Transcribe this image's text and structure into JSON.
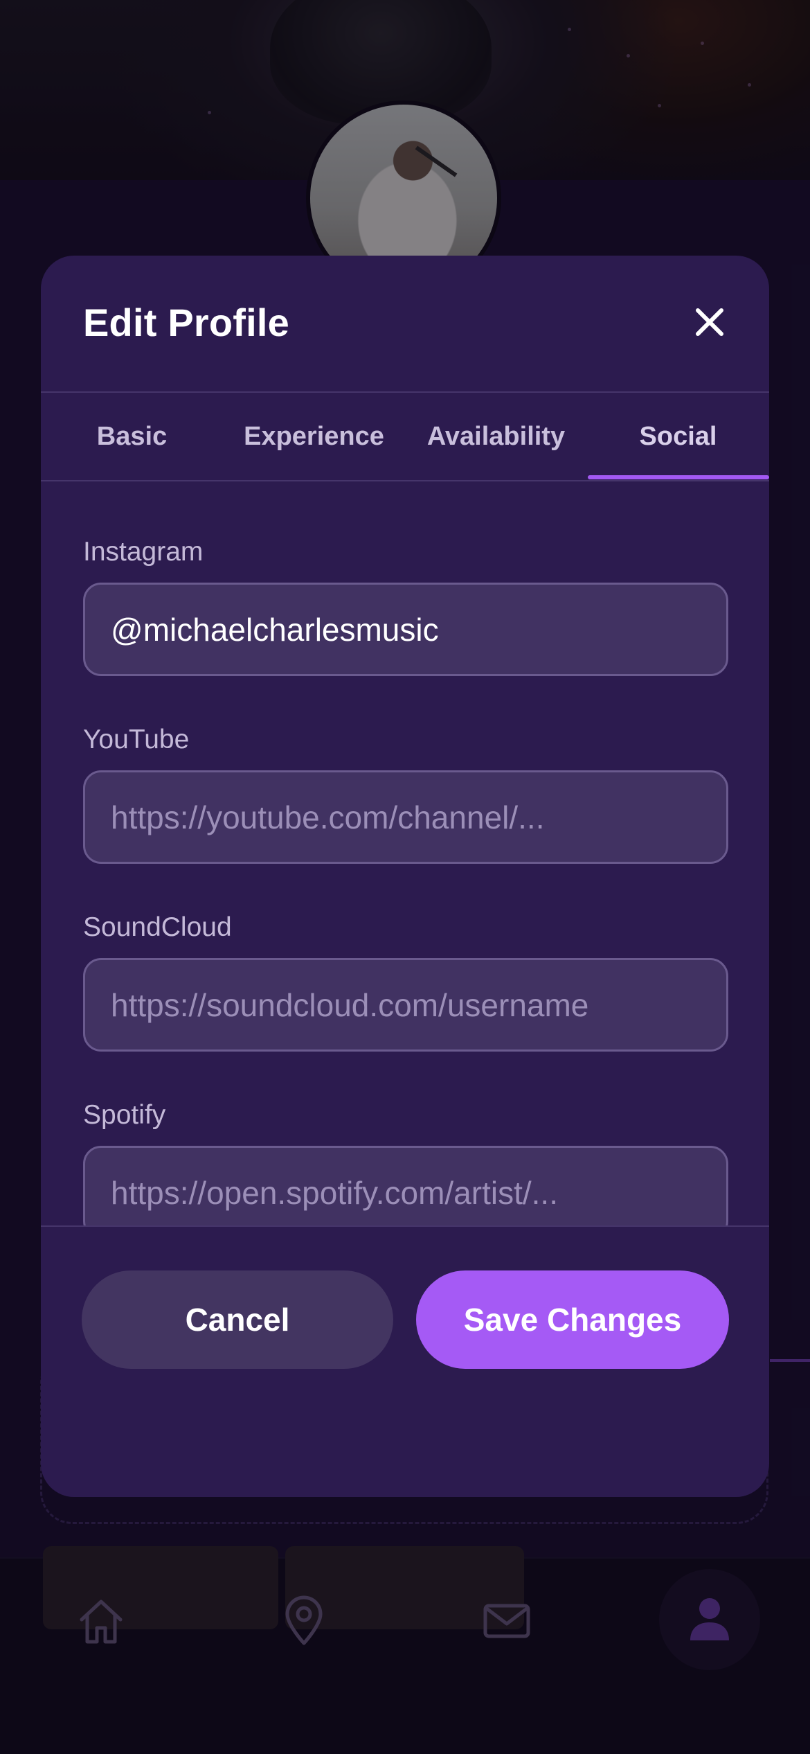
{
  "modal": {
    "title": "Edit Profile",
    "close_icon": "close-icon"
  },
  "tabs": [
    {
      "label": "Basic",
      "active": false
    },
    {
      "label": "Experience",
      "active": false
    },
    {
      "label": "Availability",
      "active": false
    },
    {
      "label": "Social",
      "active": true
    }
  ],
  "fields": {
    "instagram": {
      "label": "Instagram",
      "value": "@michaelcharlesmusic",
      "placeholder": ""
    },
    "youtube": {
      "label": "YouTube",
      "value": "",
      "placeholder": "https://youtube.com/channel/..."
    },
    "soundcloud": {
      "label": "SoundCloud",
      "value": "",
      "placeholder": "https://soundcloud.com/username"
    },
    "spotify": {
      "label": "Spotify",
      "value": "",
      "placeholder": "https://open.spotify.com/artist/..."
    }
  },
  "footer": {
    "cancel_label": "Cancel",
    "save_label": "Save Changes"
  },
  "bottom_nav": {
    "items": [
      "home-icon",
      "map-pin-icon",
      "mail-icon",
      "profile-icon"
    ]
  },
  "colors": {
    "accent": "#a55af5",
    "modal_bg": "#2c1b4f",
    "input_bg": "#413262"
  }
}
